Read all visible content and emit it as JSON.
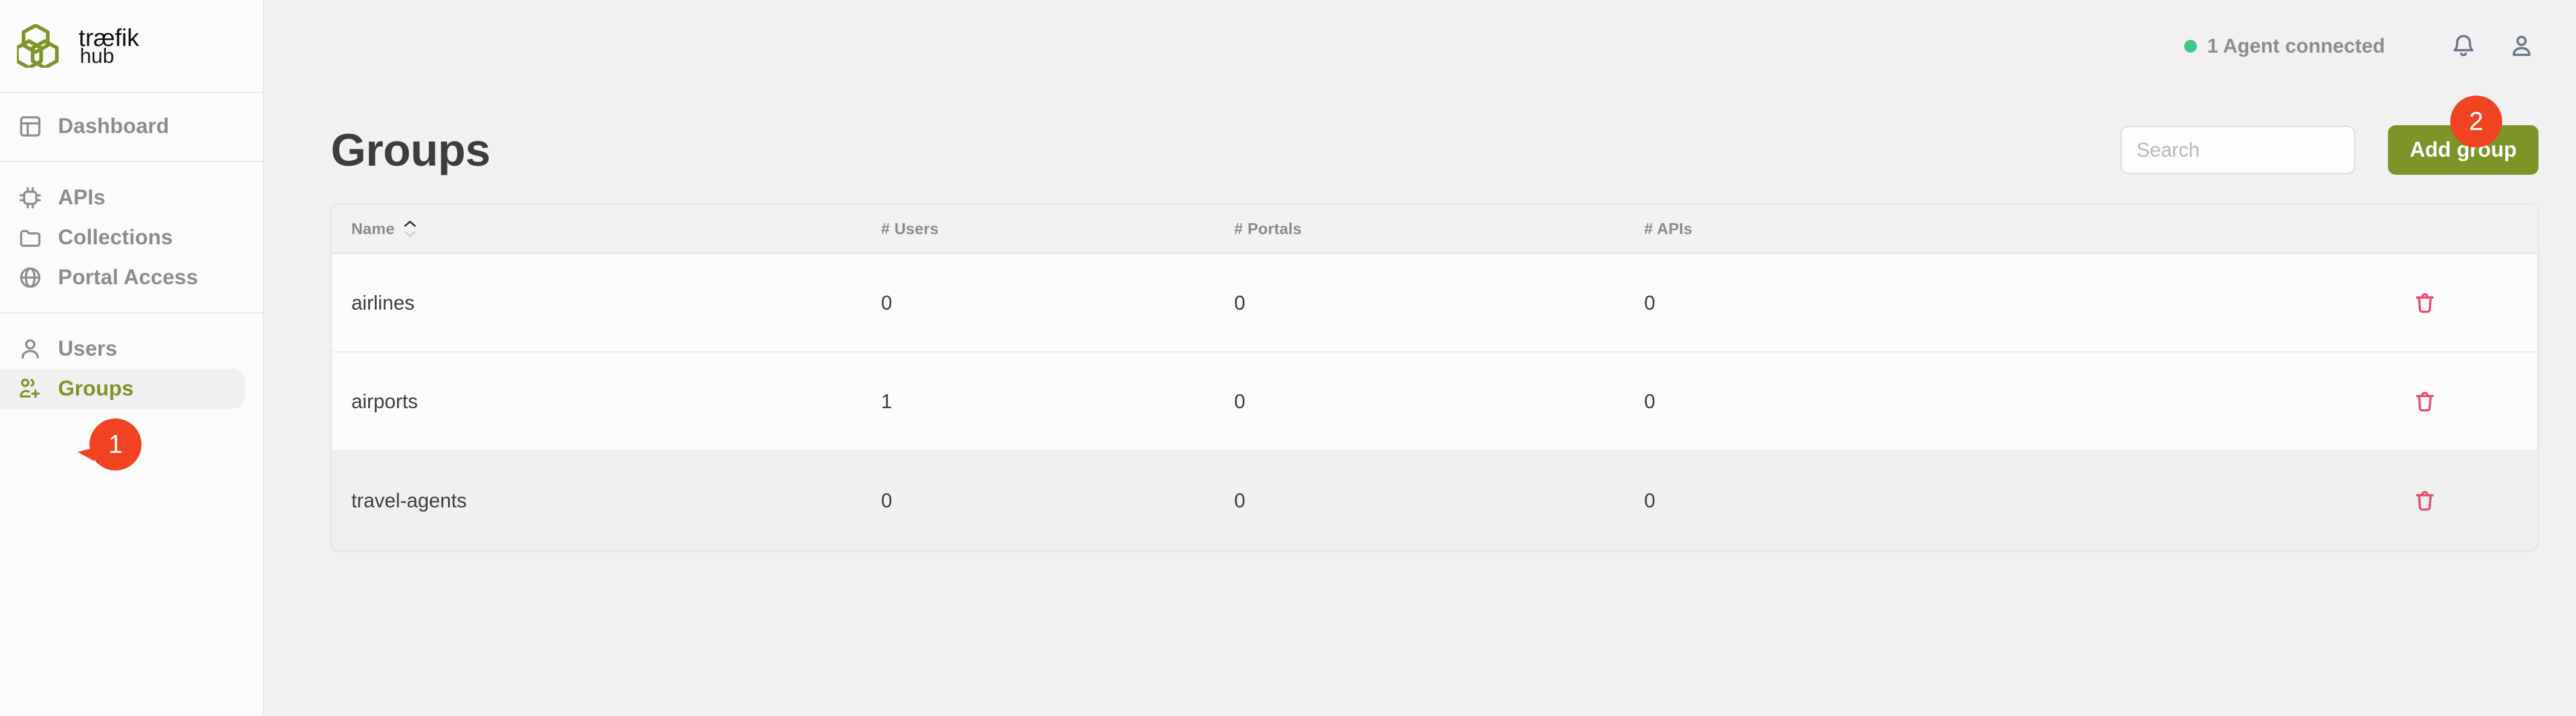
{
  "brand": {
    "name_line1": "træfik",
    "name_line2": "hub",
    "accent_color": "#7d9429",
    "logo_icon": "traefik-hexagons-logo"
  },
  "sidebar": {
    "groups": [
      {
        "items": [
          {
            "label": "Dashboard",
            "icon": "layout-dashboard-icon",
            "active": false
          }
        ]
      },
      {
        "items": [
          {
            "label": "APIs",
            "icon": "cpu-chip-icon",
            "active": false
          },
          {
            "label": "Collections",
            "icon": "folder-icon",
            "active": false
          },
          {
            "label": "Portal Access",
            "icon": "globe-icon",
            "active": false
          }
        ]
      },
      {
        "items": [
          {
            "label": "Users",
            "icon": "user-icon",
            "active": false
          },
          {
            "label": "Groups",
            "icon": "users-plus-icon",
            "active": true
          }
        ]
      }
    ],
    "groups_badge": "1"
  },
  "topbar": {
    "agent_status": "1 Agent connected",
    "status_dot_color": "#42c588",
    "notification_icon": "bell-icon",
    "account_icon": "user-avatar-icon"
  },
  "page": {
    "title": "Groups"
  },
  "search": {
    "value": "",
    "placeholder": "Search",
    "clear_icon": "circle-x-icon"
  },
  "actions": {
    "add_group_label": "Add group",
    "add_group_badge": "2",
    "badge_color": "#f04321",
    "button_color": "#7d9429"
  },
  "table": {
    "columns": [
      {
        "key": "name",
        "label": "Name",
        "sortable": true,
        "sort": "asc"
      },
      {
        "key": "users",
        "label": "# Users",
        "sortable": false
      },
      {
        "key": "portals",
        "label": "# Portals",
        "sortable": false
      },
      {
        "key": "apis",
        "label": "# APIs",
        "sortable": false
      }
    ],
    "rows": [
      {
        "name": "airlines",
        "users": "0",
        "portals": "0",
        "apis": "0",
        "delete_icon": "trash-icon",
        "hovered": false
      },
      {
        "name": "airports",
        "users": "1",
        "portals": "0",
        "apis": "0",
        "delete_icon": "trash-icon",
        "hovered": false
      },
      {
        "name": "travel-agents",
        "users": "0",
        "portals": "0",
        "apis": "0",
        "delete_icon": "trash-icon",
        "hovered": true
      }
    ]
  }
}
